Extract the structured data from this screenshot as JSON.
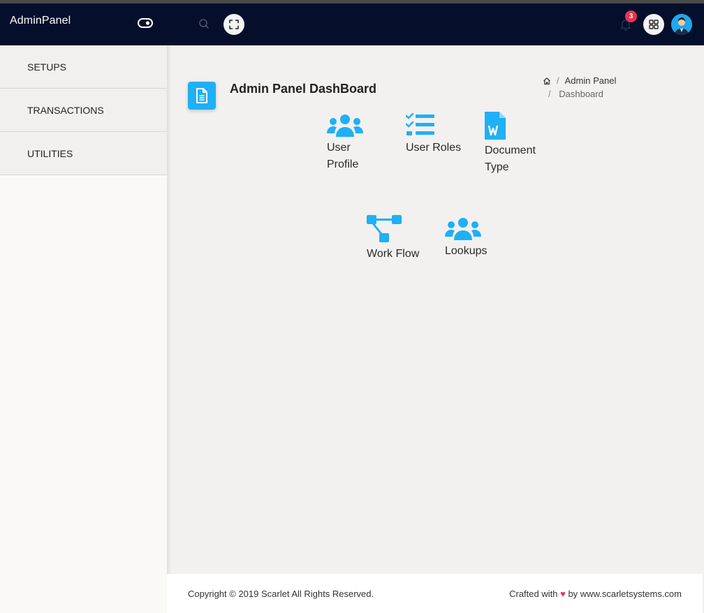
{
  "brand": {
    "name": "AdminPanel"
  },
  "header": {
    "notification_count": "3"
  },
  "sidebar": {
    "items": [
      {
        "label": "SETUPS"
      },
      {
        "label": "TRANSACTIONS"
      },
      {
        "label": "UTILITIES"
      }
    ]
  },
  "page": {
    "title": "Admin Panel DashBoard",
    "breadcrumb": {
      "parent": "Admin Panel",
      "current": "Dashboard"
    }
  },
  "tiles": [
    {
      "label_line1": "User",
      "label_line2": "Profile",
      "icon": "users-icon"
    },
    {
      "label_line1": "User Roles",
      "label_line2": "",
      "icon": "checklist-icon"
    },
    {
      "label_line1": "Document",
      "label_line2": "Type",
      "icon": "word-document-icon"
    },
    {
      "label_line1": "Work Flow",
      "label_line2": "",
      "icon": "workflow-icon"
    },
    {
      "label_line1": "Lookups",
      "label_line2": "",
      "icon": "users-icon"
    }
  ],
  "footer": {
    "copyright": "Copyright © 2019 Scarlet All Rights Reserved.",
    "crafted_prefix": "Crafted with",
    "crafted_suffix": "by www.scarletsystems.com"
  },
  "colors": {
    "topbar": "#050f2c",
    "accent": "#1fb0f5",
    "badge": "#e8344e",
    "background": "#f2f1f0"
  }
}
